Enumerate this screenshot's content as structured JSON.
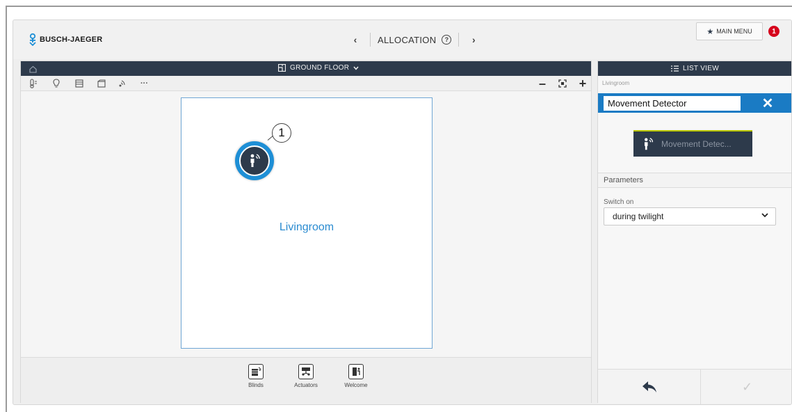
{
  "header": {
    "brand": "BUSCH-JAEGER",
    "nav_title": "ALLOCATION",
    "main_menu_label": "MAIN MENU",
    "notification_count": "1"
  },
  "floorplan": {
    "floor_title": "GROUND FLOOR",
    "room_label": "Livingroom",
    "callout_number": "1"
  },
  "categories": [
    {
      "label": "Blinds",
      "icon": "blinds-icon"
    },
    {
      "label": "Actuators",
      "icon": "actuators-icon"
    },
    {
      "label": "Welcome",
      "icon": "welcome-icon"
    }
  ],
  "detail": {
    "list_view_label": "LIST VIEW",
    "breadcrumb": "Livingroom",
    "name_value": "Movement Detector",
    "device_tile_label": "Movement Detec...",
    "parameters_header": "Parameters",
    "switch_on_label": "Switch on",
    "switch_on_value": "during twilight"
  },
  "colors": {
    "dark_bar": "#2d3a4b",
    "accent_blue": "#1a7bc4",
    "notification_red": "#d6001c",
    "tile_accent": "#b6c200"
  }
}
